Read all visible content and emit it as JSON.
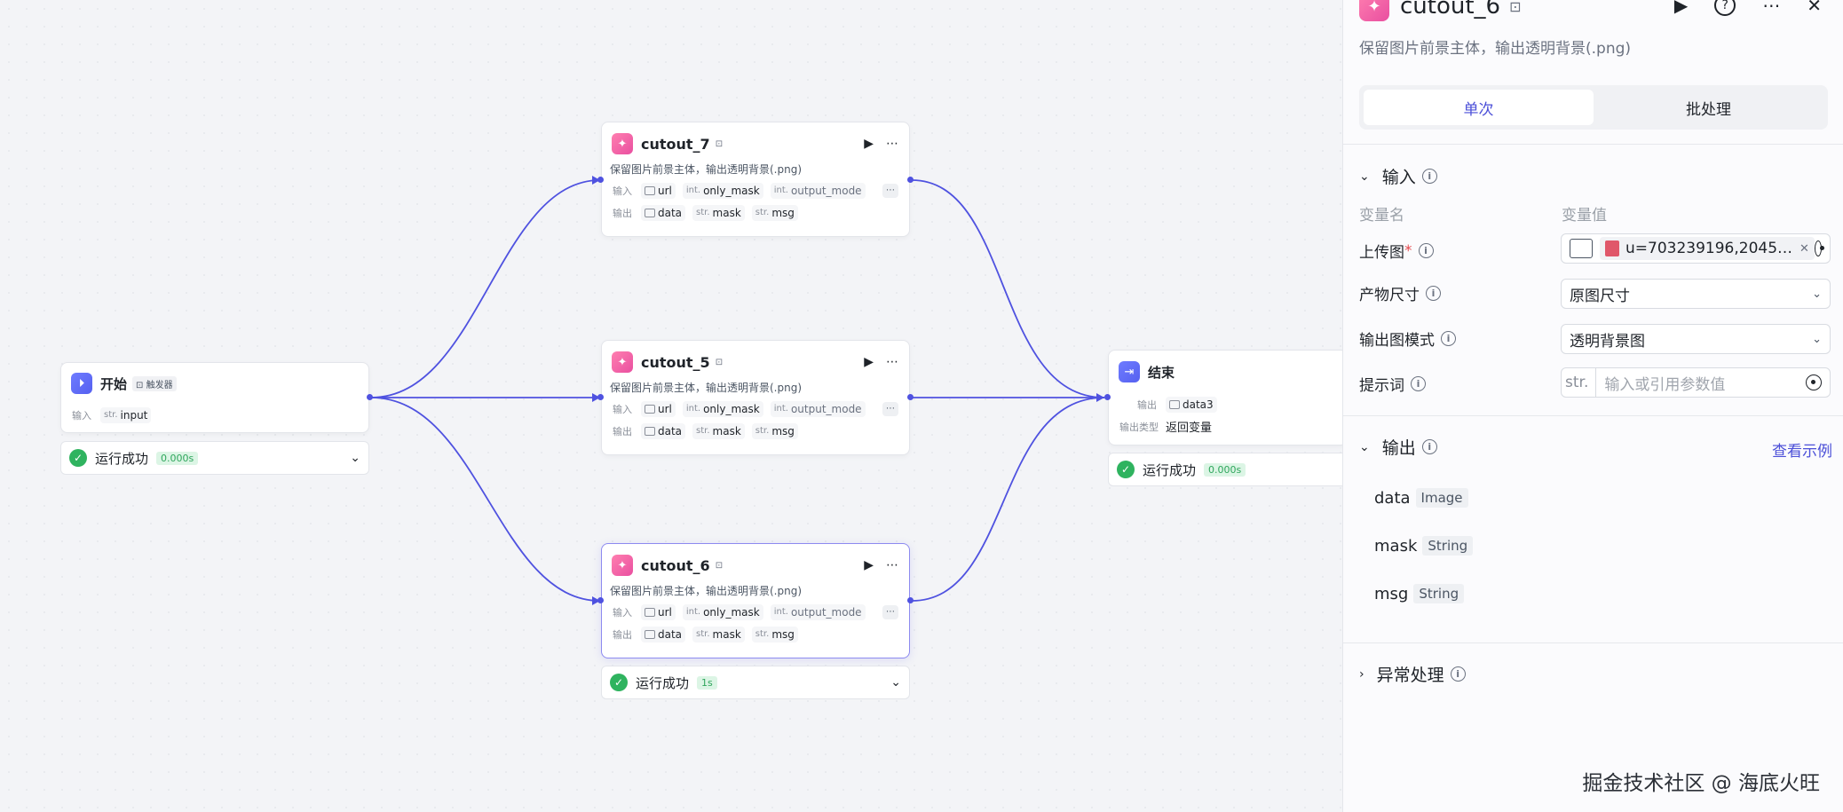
{
  "canvas": {
    "start": {
      "title": "开始",
      "trigger": "触发器",
      "input_label": "输入",
      "input_type": "str.",
      "input_name": "input",
      "status": "运行成功",
      "time": "0.000s"
    },
    "cutout7": {
      "title": "cutout_7",
      "desc": "保留图片前景主体，输出透明背景(.png)",
      "in_label": "输入",
      "out_label": "输出",
      "inputs": [
        {
          "type": "",
          "name": "url"
        },
        {
          "type": "int.",
          "name": "only_mask"
        },
        {
          "type": "int.",
          "name": "output_mode"
        }
      ],
      "outputs": [
        {
          "type": "",
          "name": "data"
        },
        {
          "type": "str.",
          "name": "mask"
        },
        {
          "type": "str.",
          "name": "msg"
        }
      ]
    },
    "cutout5": {
      "title": "cutout_5",
      "desc": "保留图片前景主体，输出透明背景(.png)",
      "in_label": "输入",
      "out_label": "输出",
      "inputs": [
        {
          "type": "",
          "name": "url"
        },
        {
          "type": "int.",
          "name": "only_mask"
        },
        {
          "type": "int.",
          "name": "output_mode"
        }
      ],
      "outputs": [
        {
          "type": "",
          "name": "data"
        },
        {
          "type": "str.",
          "name": "mask"
        },
        {
          "type": "str.",
          "name": "msg"
        }
      ]
    },
    "cutout6": {
      "title": "cutout_6",
      "desc": "保留图片前景主体，输出透明背景(.png)",
      "in_label": "输入",
      "out_label": "输出",
      "inputs": [
        {
          "type": "",
          "name": "url"
        },
        {
          "type": "int.",
          "name": "only_mask"
        },
        {
          "type": "int.",
          "name": "output_mode"
        }
      ],
      "outputs": [
        {
          "type": "",
          "name": "data"
        },
        {
          "type": "str.",
          "name": "mask"
        },
        {
          "type": "str.",
          "name": "msg"
        }
      ],
      "status": "运行成功",
      "time": "1s"
    },
    "end": {
      "title": "结束",
      "out_label": "输出",
      "out_var": "data3",
      "type_label": "输出类型",
      "type_value": "返回变量",
      "status": "运行成功",
      "time": "0.000s"
    }
  },
  "panel": {
    "title": "cutout_6",
    "desc": "保留图片前景主体，输出透明背景(.png)",
    "tabs": [
      "单次",
      "批处理"
    ],
    "input_section": "输入",
    "col_name": "变量名",
    "col_value": "变量值",
    "fields": {
      "upload_label": "上传图",
      "upload_file": "u=703239196,2045…",
      "size_label": "产物尺寸",
      "size_value": "原图尺寸",
      "mode_label": "输出图模式",
      "mode_value": "透明背景图",
      "prompt_label": "提示词",
      "prompt_prefix": "str.",
      "prompt_placeholder": "输入或引用参数值"
    },
    "output_section": "输出",
    "view_example": "查看示例",
    "outputs": [
      {
        "name": "data",
        "type": "Image"
      },
      {
        "name": "mask",
        "type": "String"
      },
      {
        "name": "msg",
        "type": "String"
      }
    ],
    "error_section": "异常处理"
  },
  "watermark": "掘金技术社区 @ 海底火旺",
  "colors": {
    "accent": "#4f52e0",
    "success": "#2fb35f",
    "node_icon_pink": "#e94fa0"
  }
}
